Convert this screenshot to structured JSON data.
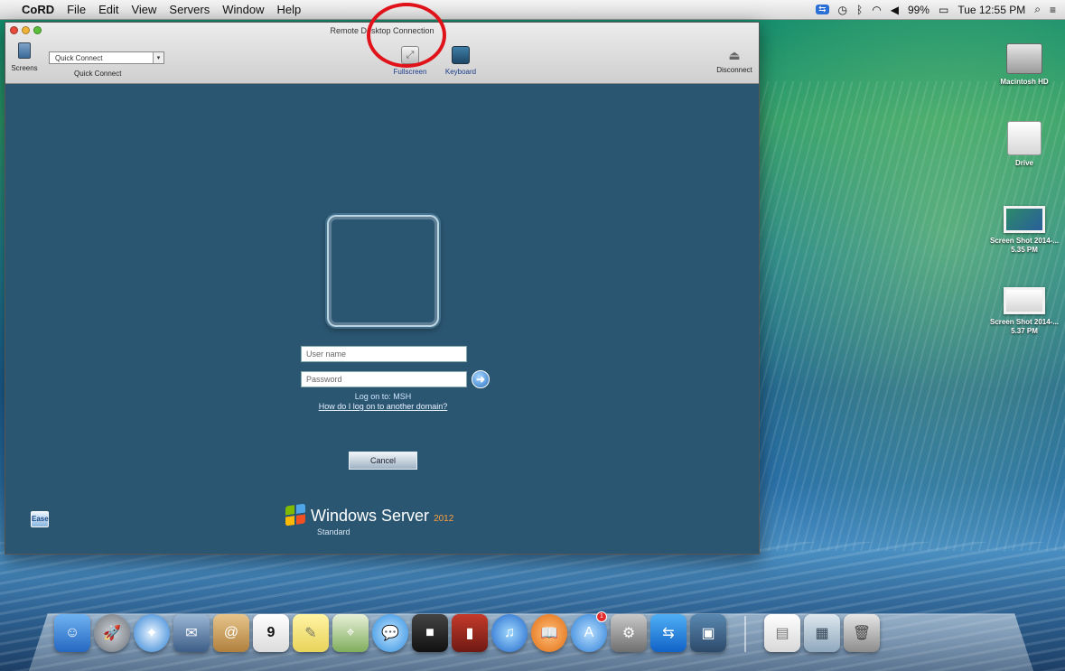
{
  "menubar": {
    "app_name": "CoRD",
    "items": [
      "File",
      "Edit",
      "View",
      "Servers",
      "Window",
      "Help"
    ],
    "clock": "Tue 12:55 PM",
    "battery": "99%"
  },
  "window": {
    "title": "Remote Desktop Connection",
    "toolbar": {
      "screens_label": "Screens",
      "quick_connect_value": "Quick Connect",
      "quick_connect_label": "Quick Connect",
      "fullscreen_label": "Fullscreen",
      "keyboard_label": "Keyboard",
      "disconnect_label": "Disconnect"
    }
  },
  "remote": {
    "username_placeholder": "User name",
    "password_placeholder": "Password",
    "logon_to": "Log on to: MSH",
    "how_to_logon": "How do I log on to another domain?",
    "cancel_label": "Cancel",
    "ease_label": "Ease",
    "brand_name": "Windows Server",
    "brand_version": "2012",
    "edition": "Standard"
  },
  "desktop_icons": [
    {
      "label": "Macintosh HD"
    },
    {
      "label": "Drive"
    },
    {
      "label": "Screen Shot 2014-... 5.35 PM"
    },
    {
      "label": "Screen Shot 2014-... 5.37 PM"
    }
  ],
  "dock": {
    "app_store_badge": "1",
    "calendar_day": "9"
  },
  "colors": {
    "remote_bg": "#2b5672",
    "highlight": "#e0121a"
  }
}
